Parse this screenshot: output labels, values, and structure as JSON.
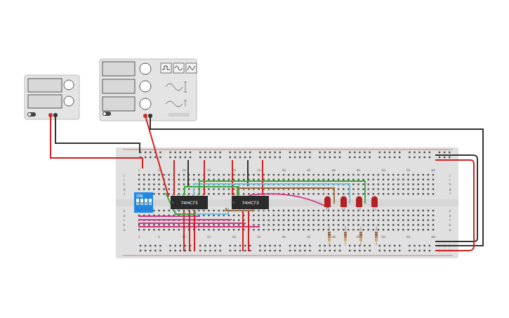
{
  "power_supply": {
    "switch_on": false
  },
  "function_generator": {
    "switch_on": false
  },
  "breadboard": {
    "column_labels": [
      "1",
      "5",
      "10",
      "15",
      "20",
      "25",
      "30",
      "35",
      "40",
      "45",
      "50",
      "55",
      "60"
    ],
    "row_labels": [
      "j",
      "i",
      "h",
      "g",
      "f",
      "e",
      "d",
      "c",
      "b",
      "a"
    ]
  },
  "dip_switch": {
    "label": "ON",
    "switches": [
      {
        "label": "1",
        "on": false
      },
      {
        "label": "2",
        "on": false
      },
      {
        "label": "3",
        "on": false
      },
      {
        "label": "4",
        "on": false
      }
    ]
  },
  "chips": [
    {
      "label": "74HC73"
    },
    {
      "label": "74HC73"
    }
  ],
  "leds": [
    {
      "lit": false
    },
    {
      "lit": false
    },
    {
      "lit": false
    },
    {
      "lit": false
    }
  ]
}
